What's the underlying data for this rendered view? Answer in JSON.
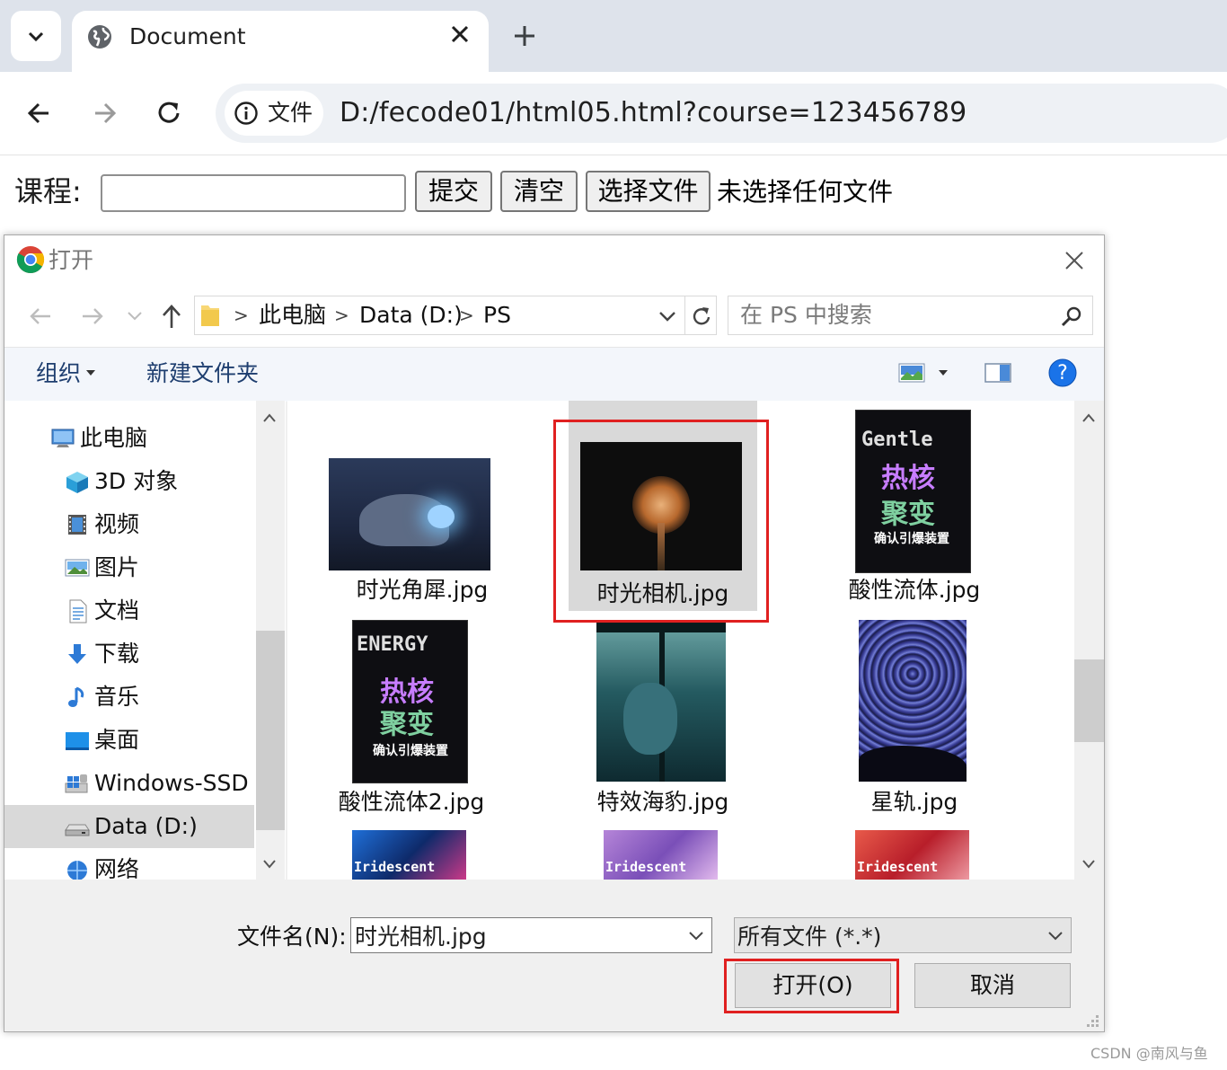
{
  "browser": {
    "tab_title": "Document",
    "omnibox": {
      "security_chip": "文件",
      "url": "D:/fecode01/html05.html?course=123456789"
    }
  },
  "page": {
    "course_label": "课程:",
    "course_value": "",
    "submit_label": "提交",
    "reset_label": "清空",
    "file_button_label": "选择文件",
    "file_status": "未选择任何文件"
  },
  "dialog": {
    "title": "打开",
    "breadcrumb": [
      "此电脑",
      "Data (D:)",
      "PS"
    ],
    "search_placeholder": "在 PS 中搜索",
    "commands": {
      "organize": "组织",
      "new_folder": "新建文件夹"
    },
    "nav_items": [
      {
        "label": "此电脑",
        "icon": "computer-icon"
      },
      {
        "label": "3D 对象",
        "icon": "3d-objects-icon"
      },
      {
        "label": "视频",
        "icon": "videos-icon"
      },
      {
        "label": "图片",
        "icon": "pictures-icon"
      },
      {
        "label": "文档",
        "icon": "documents-icon"
      },
      {
        "label": "下载",
        "icon": "downloads-icon"
      },
      {
        "label": "音乐",
        "icon": "music-icon"
      },
      {
        "label": "桌面",
        "icon": "desktop-icon"
      },
      {
        "label": "Windows-SSD (",
        "icon": "windows-drive-icon"
      },
      {
        "label": "Data (D:)",
        "icon": "drive-icon",
        "selected": true
      },
      {
        "label": "网络",
        "icon": "network-icon"
      }
    ],
    "files": [
      {
        "name": "时光角犀.jpg"
      },
      {
        "name": "时光相机.jpg",
        "selected": true
      },
      {
        "name": "酸性流体.jpg",
        "poster_lines": [
          "Gentle",
          "热核",
          "聚变",
          "确认引爆装置"
        ]
      },
      {
        "name": "酸性流体2.jpg",
        "poster_lines": [
          "ENERGY",
          "热核",
          "聚变",
          "确认引爆装置"
        ]
      },
      {
        "name": "特效海豹.jpg"
      },
      {
        "name": "星轨.jpg"
      },
      {
        "name": "",
        "poster_lines": [
          "Iridescent"
        ]
      },
      {
        "name": "",
        "poster_lines": [
          "Iridescent"
        ]
      },
      {
        "name": "",
        "poster_lines": [
          "Iridescent"
        ]
      }
    ],
    "filename_label": "文件名(N):",
    "filename_value": "时光相机.jpg",
    "filetype_value": "所有文件 (*.*)",
    "open_label": "打开(O)",
    "cancel_label": "取消"
  },
  "watermark": "CSDN @南风与鱼",
  "colors": {
    "highlight_red": "#e02020",
    "help_blue": "#1a73e8",
    "selection_gray": "#d9d9d9"
  }
}
